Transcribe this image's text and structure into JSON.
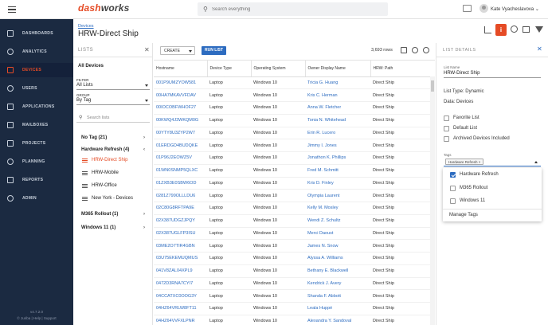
{
  "app": {
    "logo_dash": "dash",
    "logo_works": "works",
    "search_placeholder": "Search everything",
    "user_name": "Kate Vyachеslavova"
  },
  "nav": {
    "items": [
      {
        "label": "DASHBOARDS",
        "icon": "dashboard-icon"
      },
      {
        "label": "ANALYTICS",
        "icon": "analytics-icon"
      },
      {
        "label": "DEVICES",
        "icon": "devices-icon",
        "active": true
      },
      {
        "label": "USERS",
        "icon": "users-icon"
      },
      {
        "label": "APPLICATIONS",
        "icon": "applications-icon"
      },
      {
        "label": "MAILBOXES",
        "icon": "mailboxes-icon"
      },
      {
        "label": "PROJECTS",
        "icon": "projects-icon"
      },
      {
        "label": "PLANNING",
        "icon": "planning-icon"
      },
      {
        "label": "REPORTS",
        "icon": "reports-icon"
      },
      {
        "label": "ADMIN",
        "icon": "admin-icon"
      }
    ],
    "version": "v4.7.2.0",
    "footer_links": "© Juriba | Help | Support"
  },
  "header": {
    "breadcrumb": "Devices",
    "title": "HRW-Direct Ship"
  },
  "lists_panel": {
    "heading": "LISTS",
    "all_devices": "All Devices",
    "filter_label": "FILTER",
    "filter_value": "All Lists",
    "group_label": "GROUP",
    "group_value": "By Tag",
    "search_placeholder": "Search lists",
    "groups": [
      {
        "label": "No Tag (21)",
        "chevron": "›"
      },
      {
        "label": "Hardware Refresh (4)",
        "chevron": "‹"
      },
      {
        "label": "M365 Rollout (1)",
        "chevron": "›"
      },
      {
        "label": "Windows 11 (1)",
        "chevron": "›"
      }
    ],
    "items": [
      {
        "label": "HRW-Direct Ship",
        "active": true
      },
      {
        "label": "HRW-Mobile"
      },
      {
        "label": "HRW-Office"
      },
      {
        "label": "New York - Devices"
      }
    ]
  },
  "toolbar": {
    "create_label": "CREATE",
    "run_list_label": "RUN LIST",
    "rows_count": "3,693 rows"
  },
  "grid": {
    "columns": [
      "Hostname",
      "Device Type",
      "Operating System",
      "Owner Display Name",
      "HRW: Path"
    ],
    "rows": [
      [
        "001P9UMZYOW581",
        "Laptop",
        "Windows 10",
        "Tricia G. Huang",
        "Direct Ship"
      ],
      [
        "00HA7MKAVVFDAV",
        "Laptop",
        "Windows 10",
        "Kris C. Herman",
        "Direct Ship"
      ],
      [
        "00IOCOBFWHOF27",
        "Laptop",
        "Windows 10",
        "Anna W. Fletcher",
        "Direct Ship"
      ],
      [
        "00KWQ4J3WKQM0G",
        "Laptop",
        "Windows 10",
        "Tonia N. Whitehead",
        "Direct Ship"
      ],
      [
        "00YTY8U3ZYP2W7",
        "Laptop",
        "Windows 10",
        "Erin R. Lucero",
        "Direct Ship"
      ],
      [
        "01ERDGD4BUDQKE",
        "Laptop",
        "Windows 10",
        "Jimmy I. Jones",
        "Direct Ship"
      ],
      [
        "01P96J2EOWZ5V",
        "Laptop",
        "Windows 10",
        "Jonathon K. Phillips",
        "Direct Ship"
      ],
      [
        "01WN0SNMP5QLXC",
        "Laptop",
        "Windows 10",
        "Fred M. Schmitt",
        "Direct Ship"
      ],
      [
        "01ZXB3E0SBW6OD",
        "Laptop",
        "Windows 10",
        "Kris D. Finley",
        "Direct Ship"
      ],
      [
        "0281Z799OLLLDU6",
        "Laptop",
        "Windows 10",
        "Olympia Laurent",
        "Direct Ship"
      ],
      [
        "02C80G8RFTPA9E",
        "Laptop",
        "Windows 10",
        "Kelly M. Mosley",
        "Direct Ship"
      ],
      [
        "02X387UDGZJPQY",
        "Laptop",
        "Windows 10",
        "Wendi Z. Schultz",
        "Direct Ship"
      ],
      [
        "02X387UGLFP3ISU",
        "Laptop",
        "Windows 10",
        "Merci Daoust",
        "Direct Ship"
      ],
      [
        "03ME2O7TIR4GBN",
        "Laptop",
        "Windows 10",
        "James N. Snow",
        "Direct Ship"
      ],
      [
        "03U75EKEMUQMUS",
        "Laptop",
        "Windows 10",
        "Alyssa A. Williams",
        "Direct Ship"
      ],
      [
        "041V8ZAL04XPL9",
        "Laptop",
        "Windows 10",
        "Bethany E. Blackwell",
        "Direct Ship"
      ],
      [
        "0472D3RNA7CYI7",
        "Laptop",
        "Windows 10",
        "Kendrick J. Avery",
        "Direct Ship"
      ],
      [
        "04CCATXC0OOG3Y",
        "Laptop",
        "Windows 10",
        "Shanda F. Abbott",
        "Direct Ship"
      ],
      [
        "04HZ64VRLW8FT11",
        "Laptop",
        "Windows 10",
        "Leala Huppé",
        "Direct Ship"
      ],
      [
        "04HZ64VVFXLPNR",
        "Laptop",
        "Windows 10",
        "Alexandra Y. Sandoval",
        "Direct Ship"
      ]
    ]
  },
  "details": {
    "heading": "LIST DETAILS",
    "name_label": "List Name",
    "name_value": "HRW-Direct Ship",
    "list_type": "List Type: Dynamic",
    "data": "Data: Devices",
    "favorite": "Favorite List",
    "default": "Default List",
    "archived": "Archived Devices Included",
    "tags_label": "Tags",
    "tag_chip": "Hardware Refresh",
    "dropdown": [
      {
        "label": "Hardware Refresh",
        "checked": true
      },
      {
        "label": "M365 Rollout",
        "checked": false
      },
      {
        "label": "Windows 11",
        "checked": false
      }
    ],
    "manage_tags": "Manage Tags"
  },
  "colors": {
    "accent": "#e54b25",
    "nav_bg": "#1b2a41",
    "link": "#2d6cc0"
  }
}
